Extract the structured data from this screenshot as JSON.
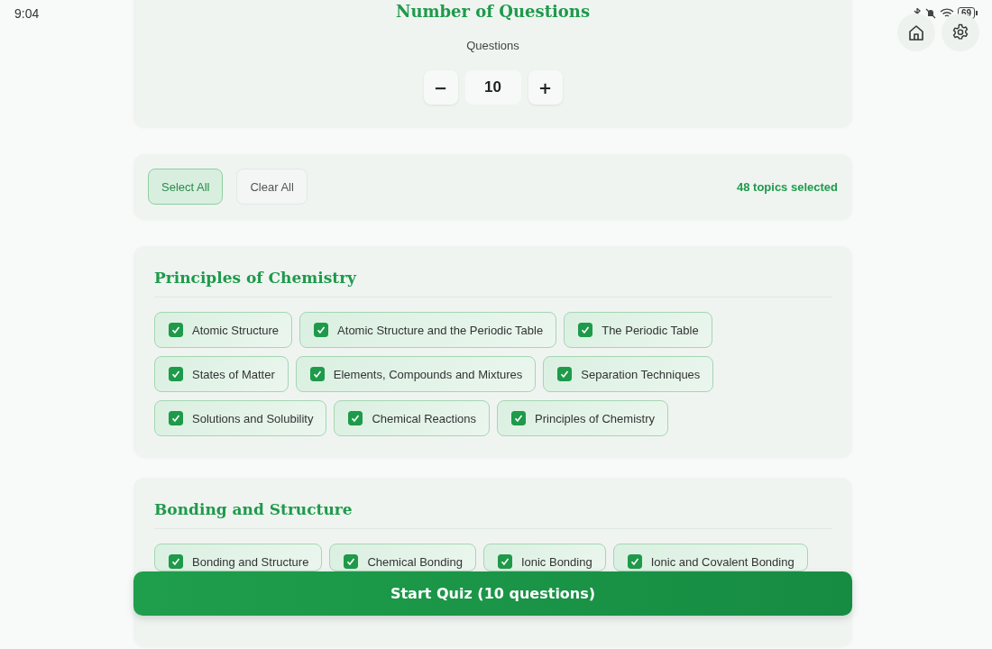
{
  "status_bar": {
    "time": "9:04",
    "battery": "69"
  },
  "question_count": {
    "title": "Number of Questions",
    "label": "Questions",
    "value": "10",
    "decrement": "−",
    "increment": "+"
  },
  "selection_bar": {
    "select_all": "Select All",
    "clear_all": "Clear All",
    "summary": "48 topics selected"
  },
  "sections": [
    {
      "title": "Principles of Chemistry",
      "topics": [
        {
          "label": "Atomic Structure",
          "checked": true
        },
        {
          "label": "Atomic Structure and the Periodic Table",
          "checked": true
        },
        {
          "label": "The Periodic Table",
          "checked": true
        },
        {
          "label": "States of Matter",
          "checked": true
        },
        {
          "label": "Elements, Compounds and Mixtures",
          "checked": true
        },
        {
          "label": "Separation Techniques",
          "checked": true
        },
        {
          "label": "Solutions and Solubility",
          "checked": true
        },
        {
          "label": "Chemical Reactions",
          "checked": true
        },
        {
          "label": "Principles of Chemistry",
          "checked": true
        }
      ]
    },
    {
      "title": "Bonding and Structure",
      "topics": [
        {
          "label": "Bonding and Structure",
          "checked": true
        },
        {
          "label": "Chemical Bonding",
          "checked": true
        },
        {
          "label": "Ionic Bonding",
          "checked": true
        },
        {
          "label": "Ionic and Covalent Bonding",
          "checked": true
        }
      ]
    }
  ],
  "start_button": "Start Quiz (10 questions)"
}
